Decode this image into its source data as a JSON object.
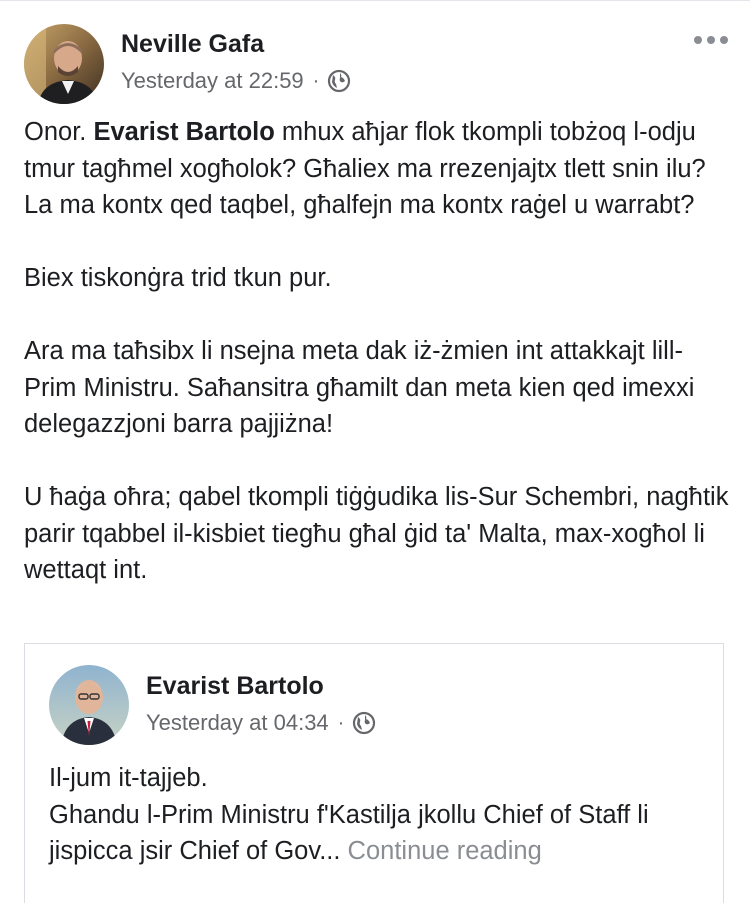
{
  "post": {
    "author": "Neville Gafa",
    "timestamp": "Yesterday at 22:59",
    "separator": "·",
    "privacy_icon": "globe-icon",
    "more_icon": "more-options-icon",
    "paragraph1_lead": "Onor. ",
    "paragraph1_bold": "Evarist Bartolo",
    "paragraph1_rest": " mhux aħjar flok tkompli tobżoq l-odju tmur tagħmel xogħolok? Għaliex ma rrezenjajtx tlett snin ilu? La ma kontx qed taqbel, għalfejn ma kontx raġel u warrabt?",
    "paragraph2": "Biex tiskonġra trid tkun pur.",
    "paragraph3": "Ara ma taħsibx li nsejna meta dak iż-żmien int attakkajt lill-Prim Ministru. Saħansitra għamilt dan meta kien qed imexxi delegazzjoni barra pajjiżna!",
    "paragraph4": "U ħaġa oħra; qabel tkompli tiġġudika lis-Sur Schembri, nagħtik parir tqabbel il-kisbiet tiegħu għal ġid ta' Malta, max-xogħol li wettaqt int."
  },
  "shared_post": {
    "author": "Evarist Bartolo",
    "timestamp": "Yesterday at 04:34",
    "separator": "·",
    "privacy_icon": "globe-icon",
    "line1": "Il-jum it-tajjeb.",
    "line2": "Ghandu l-Prim Ministru f'Kastilja jkollu Chief of Staff li jispicca jsir Chief of Gov...",
    "continue_label": "Continue reading"
  },
  "colors": {
    "text": "#1c1e21",
    "secondary": "#65676b",
    "continue": "#8a8d91",
    "border": "#dadde1"
  }
}
